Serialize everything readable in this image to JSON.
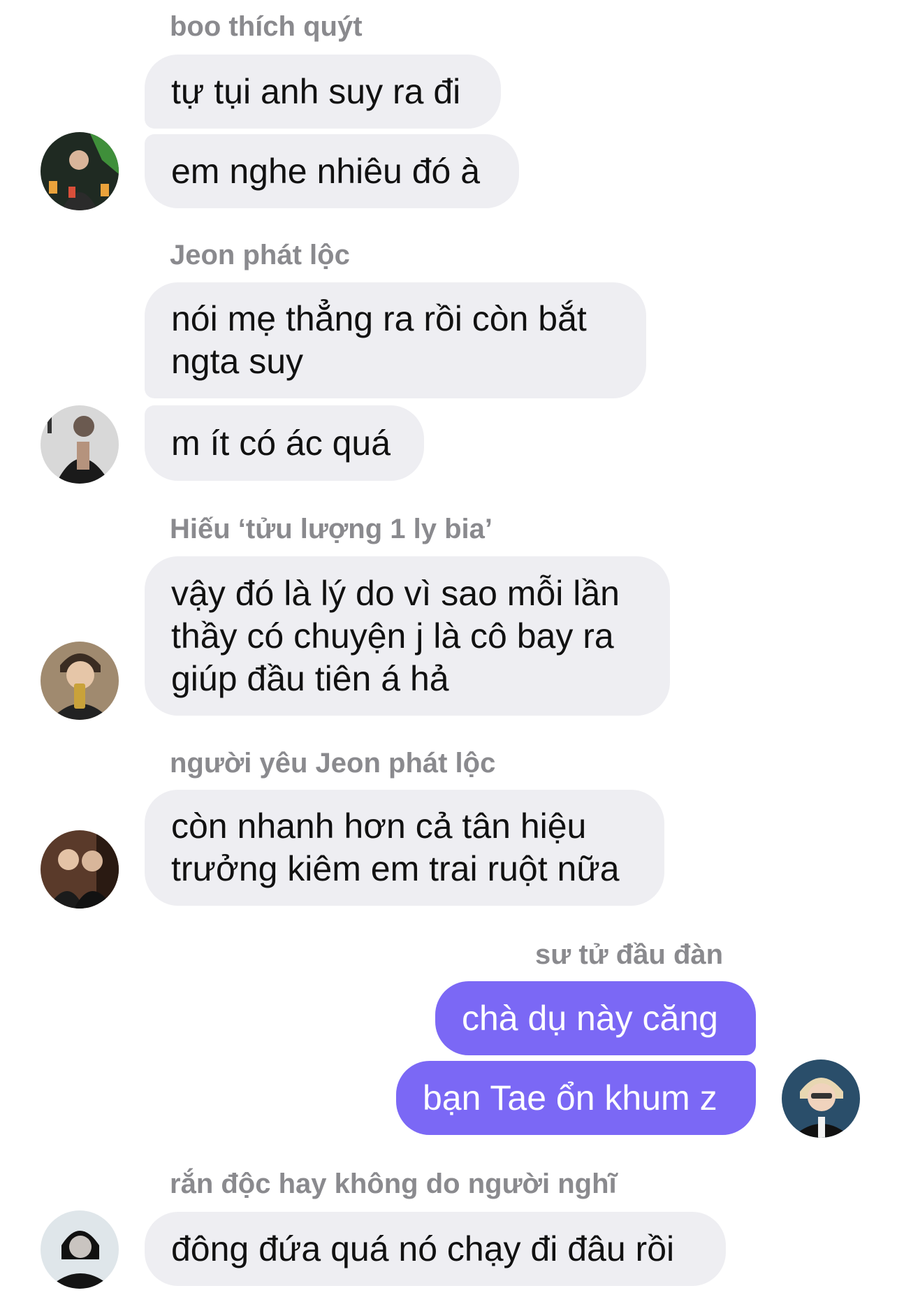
{
  "messages": {
    "g1": {
      "sender": "boo thích quýt",
      "bubble1": "tự tụi anh suy ra đi",
      "bubble2": "em nghe nhiêu đó à"
    },
    "g2": {
      "sender": "Jeon phát lộc",
      "bubble1": "nói mẹ thẳng ra rồi còn bắt\nngta suy",
      "bubble2": "m ít có ác quá"
    },
    "g3": {
      "sender": "Hiếu ‘tửu lượng 1 ly bia’",
      "bubble1": "vậy đó là lý do vì sao mỗi lần\nthầy có chuyện j là cô bay ra\ngiúp đầu tiên á hả"
    },
    "g4": {
      "sender": "người yêu Jeon phát lộc",
      "bubble1": "còn nhanh hơn cả tân hiệu\ntrưởng kiêm em trai ruột nữa"
    },
    "g5": {
      "sender": "sư tử đầu đàn",
      "bubble1": "chà dụ này căng",
      "bubble2": "bạn Tae ổn khum z"
    },
    "g6": {
      "sender": "rắn độc hay không do người nghĩ",
      "bubble1": "đông đứa quá nó chạy đi đâu rồi"
    }
  },
  "colors": {
    "incoming_bubble": "#eeeef2",
    "outgoing_bubble": "#7b68f5",
    "sender_name": "#8a8a8e"
  },
  "icons": {
    "avatar1": "profile-photo",
    "avatar2": "profile-photo",
    "avatar3": "profile-photo",
    "avatar4": "profile-photo",
    "avatar5": "profile-photo",
    "avatar6": "profile-photo"
  }
}
